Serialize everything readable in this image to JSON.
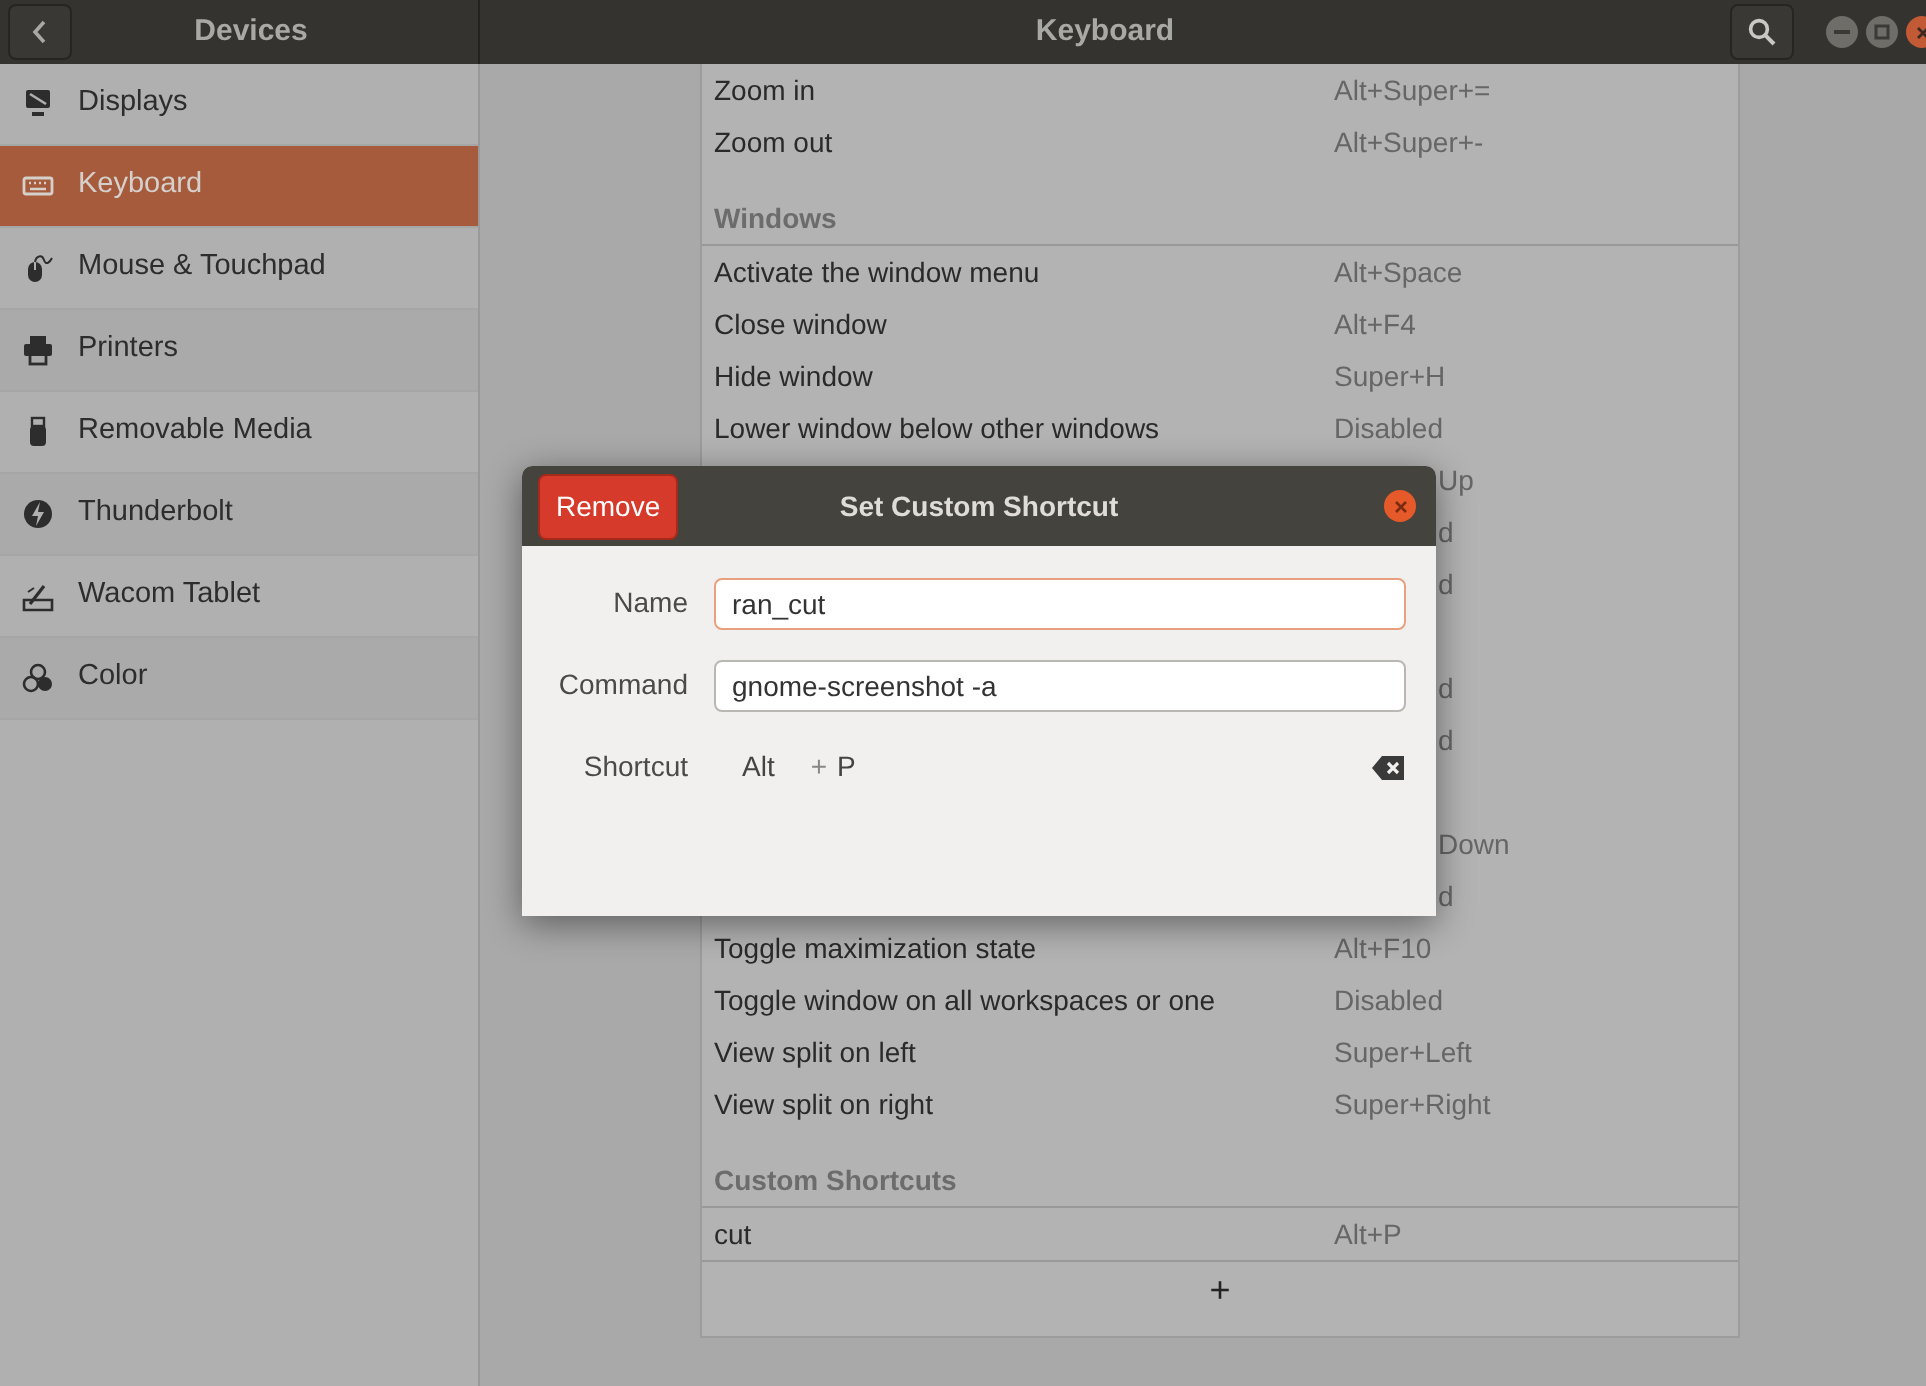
{
  "header": {
    "left_title": "Devices",
    "title": "Keyboard"
  },
  "sidebar": {
    "items": [
      {
        "label": "Displays",
        "kind": "display",
        "selected": false
      },
      {
        "label": "Keyboard",
        "kind": "keyboard",
        "selected": true
      },
      {
        "label": "Mouse & Touchpad",
        "kind": "mouse",
        "selected": false
      },
      {
        "label": "Printers",
        "kind": "printer",
        "selected": false
      },
      {
        "label": "Removable Media",
        "kind": "usb",
        "selected": false
      },
      {
        "label": "Thunderbolt",
        "kind": "bolt",
        "selected": false
      },
      {
        "label": "Wacom Tablet",
        "kind": "tablet",
        "selected": false
      },
      {
        "label": "Color",
        "kind": "color",
        "selected": false
      }
    ]
  },
  "shortcuts": {
    "sections": [
      {
        "rows": [
          {
            "kind": "row",
            "action": "Zoom in",
            "accelerator": "Alt+Super+="
          },
          {
            "kind": "row",
            "action": "Zoom out",
            "accelerator": "Alt+Super+-"
          }
        ]
      },
      {
        "title": "Windows",
        "rows": [
          {
            "kind": "row",
            "action": "Activate the window menu",
            "accelerator": "Alt+Space"
          },
          {
            "kind": "row",
            "action": "Close window",
            "accelerator": "Alt+F4"
          },
          {
            "kind": "row",
            "action": "Hide window",
            "accelerator": "Super+H"
          },
          {
            "kind": "row",
            "action": "Lower window below other windows",
            "accelerator": "Disabled"
          },
          {
            "kind": "covered",
            "accelerator": "Up"
          },
          {
            "kind": "covered",
            "accelerator": "d"
          },
          {
            "kind": "covered",
            "accelerator": "d"
          },
          {
            "kind": "covered"
          },
          {
            "kind": "covered",
            "accelerator": "d"
          },
          {
            "kind": "covered",
            "accelerator": "d"
          },
          {
            "kind": "covered"
          },
          {
            "kind": "covered",
            "accelerator": "Down"
          },
          {
            "kind": "covered",
            "accelerator": "d"
          },
          {
            "kind": "row",
            "action": "Toggle maximization state",
            "accelerator": "Alt+F10"
          },
          {
            "kind": "row",
            "action": "Toggle window on all workspaces or one",
            "accelerator": "Disabled"
          },
          {
            "kind": "row",
            "action": "View split on left",
            "accelerator": "Super+Left"
          },
          {
            "kind": "row",
            "action": "View split on right",
            "accelerator": "Super+Right"
          }
        ]
      },
      {
        "title": "Custom Shortcuts",
        "rows": [
          {
            "kind": "row",
            "action": "cut",
            "accelerator": "Alt+P"
          }
        ]
      }
    ],
    "add_button": "+"
  },
  "dialog": {
    "title": "Set Custom Shortcut",
    "remove_button": "Remove",
    "fields": [
      {
        "label": "Name",
        "value": "ran_cut",
        "focused": true
      },
      {
        "label": "Command",
        "value": "gnome-screenshot -a",
        "focused": false
      }
    ],
    "shortcut": {
      "label": "Shortcut",
      "modifier": "Alt",
      "plus": "+",
      "key": "P"
    }
  }
}
